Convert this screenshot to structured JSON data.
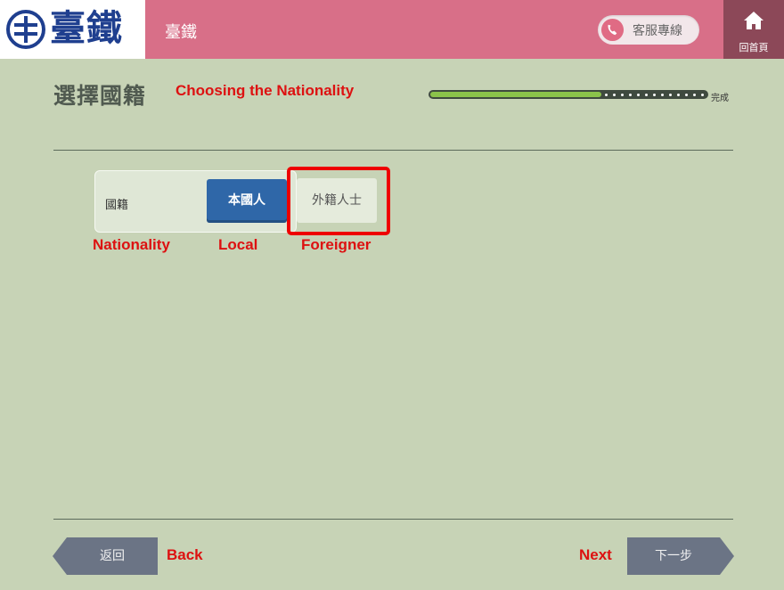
{
  "header": {
    "logo_text": "臺鐵",
    "app_name": "臺鐵",
    "customer_service_label": "客服專線",
    "home_label": "回首頁"
  },
  "page": {
    "title": "選擇國籍",
    "progress": {
      "completed_fraction": 0.62,
      "end_label": "完成"
    }
  },
  "nationality": {
    "label": "國籍",
    "options": [
      {
        "label": "本國人",
        "selected": true
      },
      {
        "label": "外籍人士",
        "selected": false
      }
    ]
  },
  "footer": {
    "back_label": "返回",
    "next_label": "下一步"
  },
  "annotations": {
    "title": "Choosing the Nationality",
    "nationality": "Nationality",
    "local": "Local",
    "foreigner": "Foreigner",
    "back": "Back",
    "next": "Next"
  },
  "colors": {
    "header": "#d86f88",
    "home": "#8c4858",
    "background": "#c7d3b6",
    "selected_button": "#2f67a8",
    "annotation": "#dd1111",
    "progress": "#8bc34a"
  }
}
